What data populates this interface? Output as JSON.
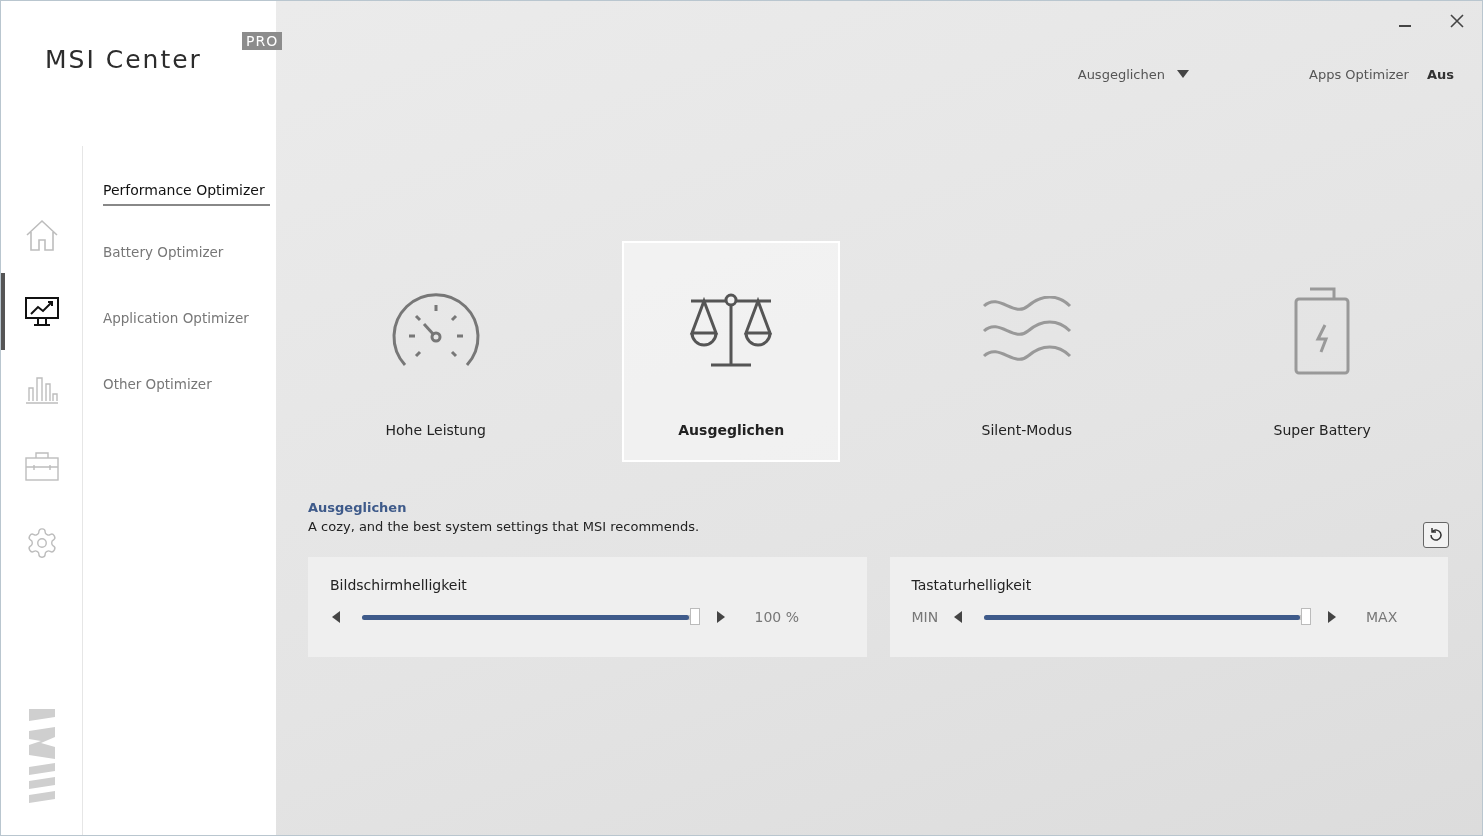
{
  "app": {
    "name": "MSI Center",
    "badge": "PRO"
  },
  "rail": [
    {
      "selected": false
    },
    {
      "selected": true
    },
    {
      "selected": false
    },
    {
      "selected": false
    },
    {
      "selected": false
    }
  ],
  "subnav": [
    {
      "label": "Performance Optimizer",
      "selected": true
    },
    {
      "label": "Battery Optimizer",
      "selected": false
    },
    {
      "label": "Application Optimizer",
      "selected": false
    },
    {
      "label": "Other Optimizer",
      "selected": false
    }
  ],
  "header": {
    "mode_dropdown": "Ausgeglichen",
    "apps_optimizer_label": "Apps Optimizer",
    "apps_optimizer_value": "Aus"
  },
  "modes": [
    {
      "label": "Hohe Leistung",
      "selected": false
    },
    {
      "label": "Ausgeglichen",
      "selected": true
    },
    {
      "label": "Silent-Modus",
      "selected": false
    },
    {
      "label": "Super Battery",
      "selected": false
    }
  ],
  "description": {
    "title": "Ausgeglichen",
    "text": "A cozy, and the best system settings that MSI recommends."
  },
  "sliders": [
    {
      "label": "Bildschirmhelligkeit",
      "level": 1.0,
      "reading": "100 %"
    },
    {
      "label": "Tastaturhelligkeit",
      "level": 1.0,
      "min_label": "MIN",
      "max_label": "MAX"
    }
  ]
}
